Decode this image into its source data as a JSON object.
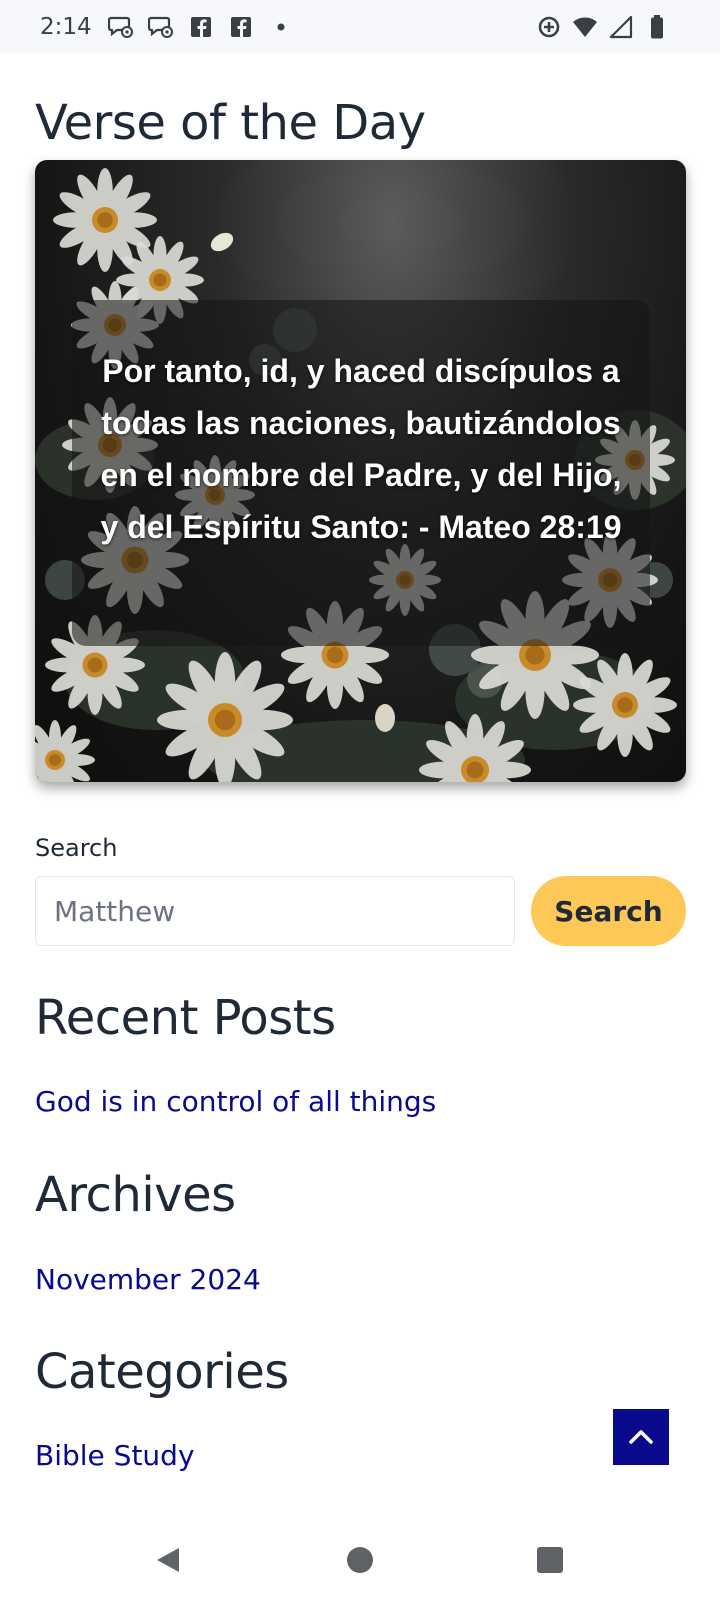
{
  "status_bar": {
    "time": "2:14",
    "left_icons": [
      "chat-settings-icon",
      "chat-settings-icon",
      "facebook-icon",
      "facebook-icon",
      "dot-icon"
    ],
    "right_icons": [
      "data-saver-icon",
      "wifi-icon",
      "cellular-signal-icon",
      "battery-icon"
    ]
  },
  "verse_of_the_day": {
    "title": "Verse of the Day",
    "text": "Por tanto, id, y haced discípulos a todas las naciones, bautizándolos en el nombre del Padre, y del Hijo, y del Espíritu Santo: - Mateo 28:19"
  },
  "search": {
    "label": "Search",
    "placeholder": "Matthew",
    "value": "",
    "button_label": "Search"
  },
  "recent_posts": {
    "title": "Recent Posts",
    "items": [
      {
        "label": "God is in control of all things"
      }
    ]
  },
  "archives": {
    "title": "Archives",
    "items": [
      {
        "label": "November 2024"
      }
    ]
  },
  "categories": {
    "title": "Categories",
    "items": [
      {
        "label": "Bible Study"
      }
    ]
  },
  "colors": {
    "link": "#0a0a8c",
    "search_button": "#fdc858",
    "back_to_top": "#0a0a8c",
    "heading": "#1f2937"
  },
  "nav_bar": {
    "icons": [
      "back-icon",
      "home-icon",
      "recents-icon"
    ]
  }
}
